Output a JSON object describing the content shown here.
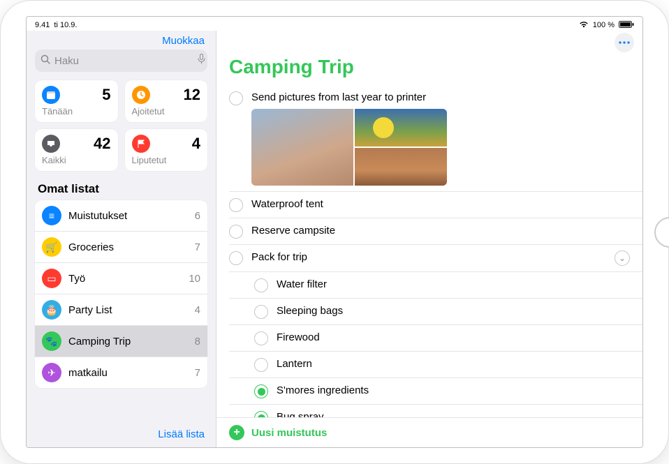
{
  "statusbar": {
    "time": "9.41",
    "date": "ti 10.9.",
    "battery": "100 %"
  },
  "sidebar": {
    "edit": "Muokkaa",
    "search_placeholder": "Haku",
    "smart": [
      {
        "label": "Tänään",
        "count": "5",
        "icon": "calendar",
        "color": "blue"
      },
      {
        "label": "Ajoitetut",
        "count": "12",
        "icon": "clock",
        "color": "orange"
      },
      {
        "label": "Kaikki",
        "count": "42",
        "icon": "inbox",
        "color": "gray"
      },
      {
        "label": "Liputetut",
        "count": "4",
        "icon": "flag",
        "color": "red"
      }
    ],
    "section_title": "Omat listat",
    "lists": [
      {
        "name": "Muistutukset",
        "count": "6",
        "color": "blue",
        "glyph": "≡",
        "selected": false
      },
      {
        "name": "Groceries",
        "count": "7",
        "color": "yellow",
        "glyph": "🛒",
        "selected": false
      },
      {
        "name": "Työ",
        "count": "10",
        "color": "red",
        "glyph": "▭",
        "selected": false
      },
      {
        "name": "Party List",
        "count": "4",
        "color": "teal",
        "glyph": "🎂",
        "selected": false
      },
      {
        "name": "Camping Trip",
        "count": "8",
        "color": "green",
        "glyph": "🐾",
        "selected": true
      },
      {
        "name": "matkailu",
        "count": "7",
        "color": "purple",
        "glyph": "✈",
        "selected": false
      }
    ],
    "add_list": "Lisää lista"
  },
  "main": {
    "title": "Camping Trip",
    "new_reminder": "Uusi muistutus",
    "reminders": [
      {
        "text": "Send pictures from last year to printer",
        "done": false,
        "attachments": true
      },
      {
        "text": "Waterproof tent",
        "done": false
      },
      {
        "text": "Reserve campsite",
        "done": false
      },
      {
        "text": "Pack for trip",
        "done": false,
        "expandable": true
      },
      {
        "text": "Water filter",
        "done": false,
        "sub": true
      },
      {
        "text": "Sleeping bags",
        "done": false,
        "sub": true
      },
      {
        "text": "Firewood",
        "done": false,
        "sub": true
      },
      {
        "text": "Lantern",
        "done": false,
        "sub": true
      },
      {
        "text": "S'mores ingredients",
        "done": true,
        "sub": true
      },
      {
        "text": "Bug spray",
        "done": true,
        "sub": true
      }
    ]
  }
}
